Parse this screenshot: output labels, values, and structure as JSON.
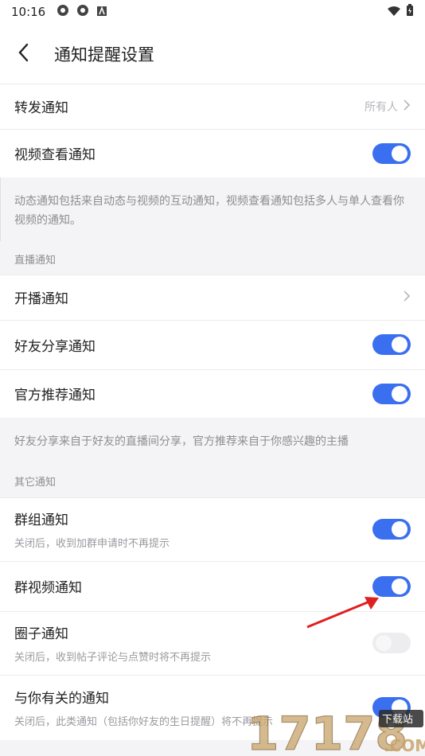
{
  "status_bar": {
    "time": "10:16",
    "icons_left": [
      "app-icon",
      "app-icon",
      "a-icon"
    ],
    "icons_right": [
      "wifi-icon",
      "battery-charging-icon"
    ]
  },
  "header": {
    "title": "通知提醒设置",
    "back_icon": "back-arrow-icon"
  },
  "group1": {
    "rows": [
      {
        "label": "转发通知",
        "value": "所有人",
        "control": "chevron"
      },
      {
        "label": "视频查看通知",
        "control": "toggle",
        "on": true
      }
    ],
    "note": "动态通知包括来自动态与视频的互动通知，视频查看通知包括多人与单人查看你视频的通知。"
  },
  "live_section": {
    "heading": "直播通知",
    "rows": [
      {
        "label": "开播通知",
        "control": "chevron"
      },
      {
        "label": "好友分享通知",
        "control": "toggle",
        "on": true
      },
      {
        "label": "官方推荐通知",
        "control": "toggle",
        "on": true
      }
    ],
    "note": "好友分享来自于好友的直播间分享，官方推荐来自于你感兴趣的主播"
  },
  "other_section": {
    "heading": "其它通知",
    "rows": [
      {
        "label": "群组通知",
        "sub": "关闭后，收到加群申请时不再提示",
        "control": "toggle",
        "on": true
      },
      {
        "label": "群视频通知",
        "control": "toggle",
        "on": true
      },
      {
        "label": "圈子通知",
        "sub": "关闭后，收到帖子评论与点赞时将不再提示",
        "control": "toggle",
        "on": false
      },
      {
        "label": "与你有关的通知",
        "sub": "关闭后，此类通知（包括你好友的生日提醒）将不再提示",
        "control": "toggle",
        "on": true
      }
    ]
  },
  "watermark": {
    "text": "17178",
    "sub": ".COM",
    "badge": "下载站"
  },
  "colors": {
    "accent": "#3a6ff0",
    "arrow": "#e02020"
  }
}
